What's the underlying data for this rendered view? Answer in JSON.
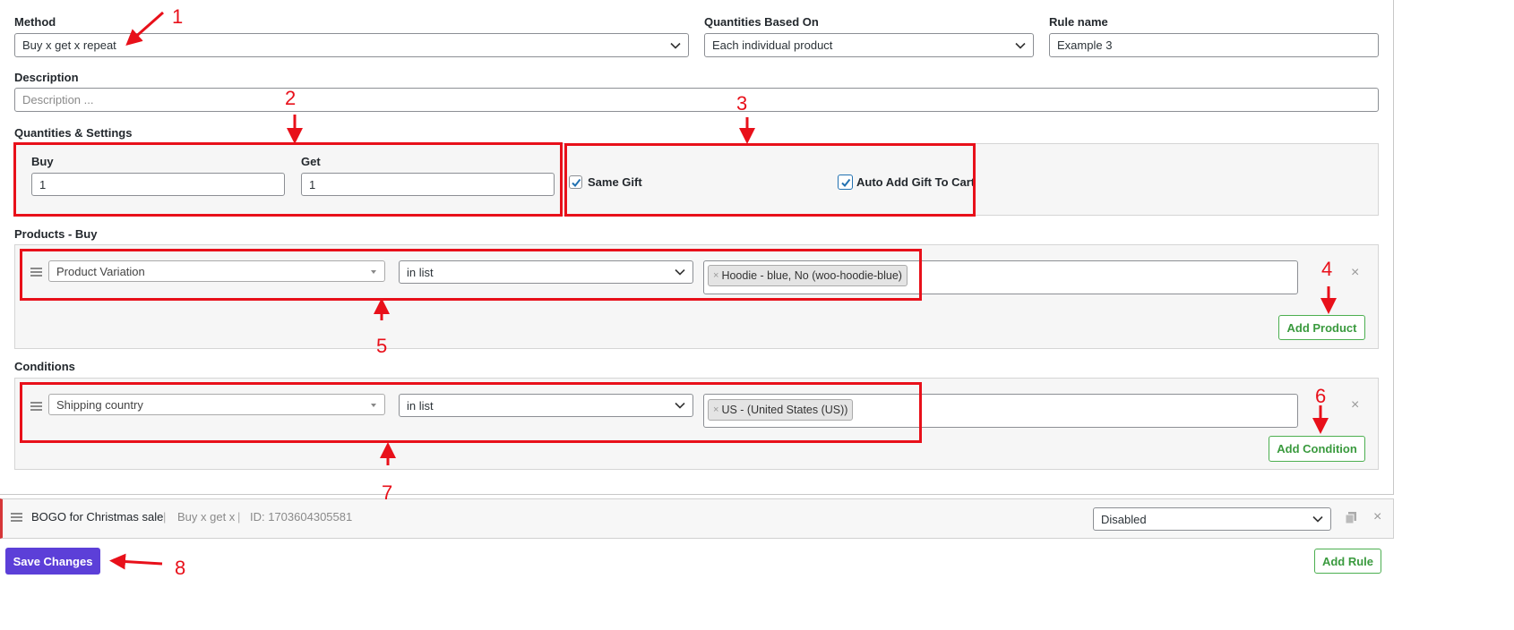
{
  "form": {
    "method_label": "Method",
    "method_value": "Buy x get x repeat",
    "quantities_based_label": "Quantities Based On",
    "quantities_based_value": "Each individual product",
    "rule_name_label": "Rule name",
    "rule_name_value": "Example 3",
    "description_label": "Description",
    "description_placeholder": "Description ...",
    "quantities_settings_label": "Quantities & Settings",
    "buy_label": "Buy",
    "buy_value": "1",
    "get_label": "Get",
    "get_value": "1",
    "same_gift_label": "Same Gift",
    "same_gift_checked": true,
    "auto_add_label": "Auto Add Gift To Cart",
    "auto_add_checked": true
  },
  "products_buy": {
    "label": "Products - Buy",
    "type_value": "Product Variation",
    "operator_value": "in list",
    "tags": [
      "Hoodie - blue, No (woo-hoodie-blue)"
    ],
    "tag_remove": "×",
    "add_button": "Add Product",
    "remove_icon": "×"
  },
  "conditions": {
    "label": "Conditions",
    "type_value": "Shipping country",
    "operator_value": "in list",
    "tags": [
      "US - (United States (US))"
    ],
    "tag_remove": "×",
    "add_button": "Add Condition",
    "remove_icon": "×"
  },
  "rule_bar": {
    "title": "BOGO for Christmas sale",
    "separator": "|",
    "method": "Buy x get x",
    "id_text": "ID: 1703604305581",
    "status_value": "Disabled",
    "close_icon": "×"
  },
  "footer": {
    "save_label": "Save Changes",
    "add_rule_label": "Add Rule"
  },
  "annotations": {
    "n1": "1",
    "n2": "2",
    "n3": "3",
    "n4": "4",
    "n5": "5",
    "n6": "6",
    "n7": "7",
    "n8": "8",
    "color": "#e8101a"
  },
  "colors": {
    "primary_button": "#5c3fd8",
    "green_button": "#3a9a3e",
    "checkbox_blue": "#2271b1",
    "disabled_indicator": "#d63638"
  }
}
